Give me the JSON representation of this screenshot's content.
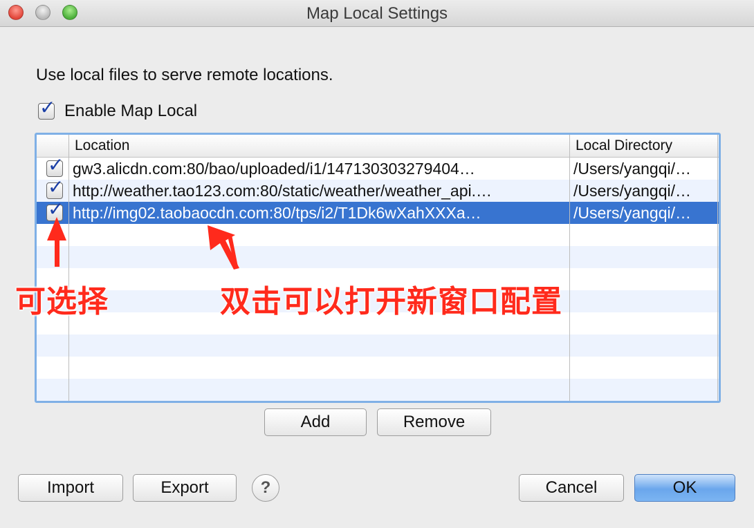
{
  "window": {
    "title": "Map Local Settings"
  },
  "intro_text": "Use local files to serve remote locations.",
  "enable": {
    "label": "Enable Map Local",
    "checked": true
  },
  "table": {
    "columns": [
      "Location",
      "Local Directory"
    ],
    "rows": [
      {
        "checked": true,
        "location": "gw3.alicdn.com:80/bao/uploaded/i1/147130303279404…",
        "local_directory": "/Users/yangqi/…"
      },
      {
        "checked": true,
        "location": "http://weather.tao123.com:80/static/weather/weather_api.…",
        "local_directory": "/Users/yangqi/…"
      },
      {
        "checked": true,
        "location": "http://img02.taobaocdn.com:80/tps/i2/T1Dk6wXahXXXa…",
        "local_directory": "/Users/yangqi/…",
        "selected": true
      }
    ]
  },
  "buttons": {
    "add": "Add",
    "remove": "Remove",
    "import": "Import",
    "export": "Export",
    "help": "?",
    "cancel": "Cancel",
    "ok": "OK"
  },
  "annotations": {
    "selectable": "可选择",
    "double_click": "双击可以打开新窗口配置"
  },
  "colors": {
    "selection": "#3874d0",
    "annotation": "#ff2a1c",
    "focus_ring": "#7fb0e6"
  }
}
